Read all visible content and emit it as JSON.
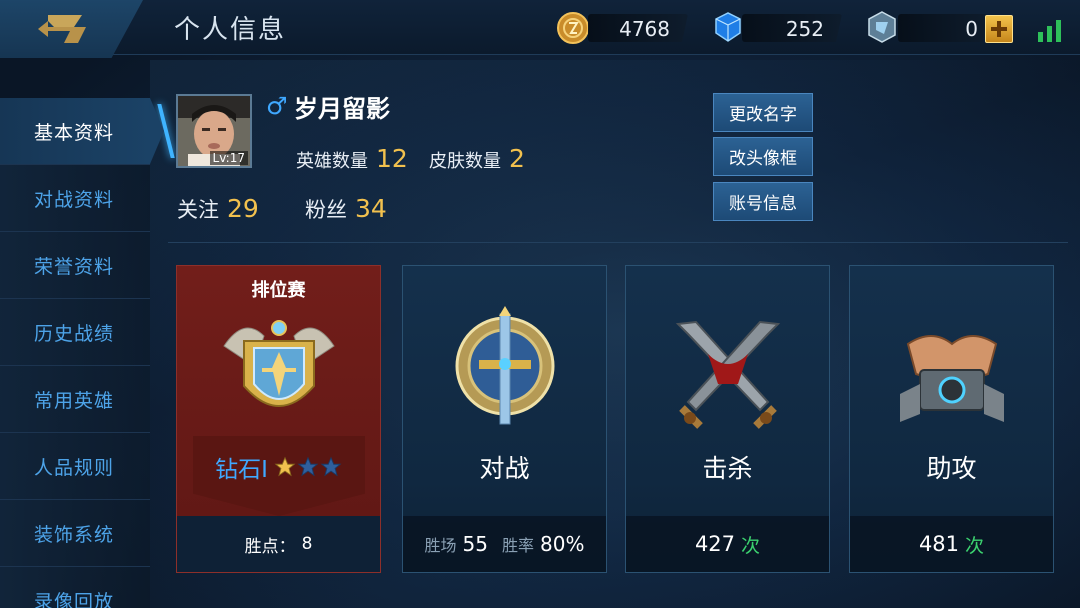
{
  "header": {
    "title": "个人信息",
    "gold": "4768",
    "diamonds": "252",
    "coupons": "0"
  },
  "sidebar": {
    "items": [
      {
        "label": "基本资料",
        "active": true
      },
      {
        "label": "对战资料"
      },
      {
        "label": "荣誉资料"
      },
      {
        "label": "历史战绩"
      },
      {
        "label": "常用英雄"
      },
      {
        "label": "人品规则"
      },
      {
        "label": "装饰系统"
      },
      {
        "label": "录像回放"
      }
    ]
  },
  "profile": {
    "gender_icon": "♂",
    "name": "岁月留影",
    "level": "Lv:17",
    "heroes_label": "英雄数量",
    "heroes_count": "12",
    "skins_label": "皮肤数量",
    "skins_count": "2",
    "follow_label": "关注",
    "follow_count": "29",
    "fans_label": "粉丝",
    "fans_count": "34"
  },
  "actions": {
    "rename": "更改名字",
    "frame": "改头像框",
    "account": "账号信息"
  },
  "cards": {
    "rank": {
      "title": "排位赛",
      "tier": "钻石I",
      "stars_filled": 1,
      "stars_total": 3,
      "points_label": "胜点：",
      "points": "8"
    },
    "battle": {
      "title": "对战",
      "wins_label": "胜场",
      "wins": "55",
      "rate_label": "胜率",
      "rate": "80%"
    },
    "kills": {
      "title": "击杀",
      "count": "427",
      "unit": "次"
    },
    "assists": {
      "title": "助攻",
      "count": "481",
      "unit": "次"
    }
  },
  "colors": {
    "accent_gold": "#f2c14e",
    "link_blue": "#4da3e8",
    "unit_green": "#3bd16f",
    "rank_red": "#721e1a"
  }
}
